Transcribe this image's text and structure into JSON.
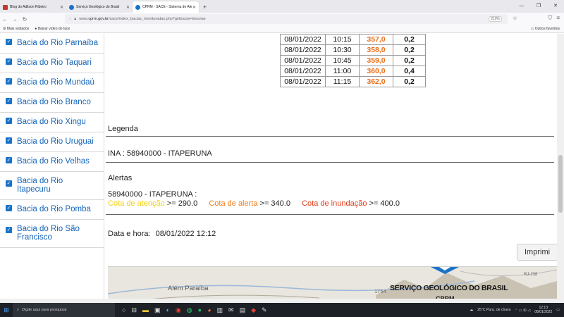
{
  "browser": {
    "tabs": [
      {
        "label": "Blog do Adilson Ribeiro",
        "color": "#c0392b"
      },
      {
        "label": "Serviço Geológico do Brasil",
        "color": "#1a73c8"
      },
      {
        "label": "CPRM - SACE - Sistema de Ale",
        "color": "#1a73c8",
        "active": true
      }
    ],
    "url_prefix": "www.",
    "url_host": "cprm.gov.br",
    "url_path": "/sace/index_bacias_monitoradas.php?getbacia=bmuriae",
    "zoom": "210%",
    "bookmarks": [
      "Mais visitados",
      "Baixar vídeo do face"
    ],
    "bookmarks_right": "Outros favoritos"
  },
  "sidebar": {
    "items": [
      {
        "label": "Bacia do Rio Parnaíba"
      },
      {
        "label": "Bacia do Rio Taquari"
      },
      {
        "label": "Bacia do Rio Mundaú"
      },
      {
        "label": "Bacia do Rio Branco"
      },
      {
        "label": "Bacia do Rio Xingu"
      },
      {
        "label": "Bacia do Rio Uruguai"
      },
      {
        "label": "Bacia do Rio Velhas"
      },
      {
        "label": "Bacia do Rio Itapecuru"
      },
      {
        "label": "Bacia do Rio Pomba"
      },
      {
        "label": "Bacia do Rio São Francisco"
      }
    ]
  },
  "readings": [
    {
      "date": "08/01/2022",
      "time": "10:15",
      "level": "357,0",
      "rain": "0,2"
    },
    {
      "date": "08/01/2022",
      "time": "10:30",
      "level": "358,0",
      "rain": "0,2"
    },
    {
      "date": "08/01/2022",
      "time": "10:45",
      "level": "359,0",
      "rain": "0,2"
    },
    {
      "date": "08/01/2022",
      "time": "11:00",
      "level": "360,0",
      "rain": "0,4"
    },
    {
      "date": "08/01/2022",
      "time": "11:15",
      "level": "362,0",
      "rain": "0,2"
    }
  ],
  "legend": {
    "title": "Legenda",
    "station": "INA : 58940000 - ITAPERUNA"
  },
  "alerts": {
    "title": "Alertas",
    "station": "58940000 - ITAPERUNA :",
    "attention_label": "Cota de atenção",
    "attention_value": ">= 290.0",
    "alert_label": "Cota de alerta",
    "alert_value": ">= 340.0",
    "flood_label": "Cota de inundação",
    "flood_value": ">= 400.0",
    "colors": {
      "attention": "#f4d012",
      "alert": "#f07a18",
      "flood": "#e03c18"
    }
  },
  "datetime": {
    "label": "Data e hora:",
    "value": "08/01/2022 12:12"
  },
  "print_button": "Imprimi",
  "map": {
    "city": "Além Paraíba",
    "marker": "1754",
    "road": "RJ-238",
    "logo_title": "SERVIÇO GEOLÓGICO DO BRASIL",
    "logo_sub": "CPRM"
  },
  "taskbar": {
    "search_placeholder": "Digite aqui para pesquisar",
    "weather": "25°C  Panc. de chuva",
    "time": "12:13",
    "date": "08/01/2022"
  }
}
